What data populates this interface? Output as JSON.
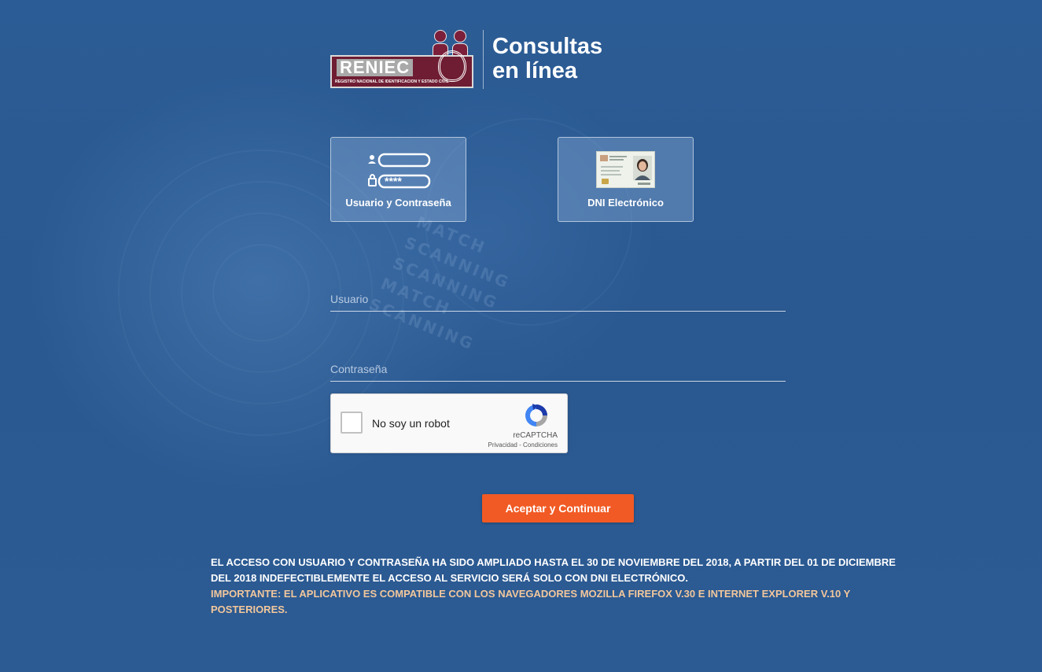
{
  "header": {
    "logo_word": "RENIEC",
    "logo_subtitle": "REGISTRO NACIONAL DE IDENTIFICACIÓN Y ESTADO CIVIL",
    "title_line1": "Consultas",
    "title_line2": "en línea"
  },
  "login_options": [
    {
      "label": "Usuario y Contraseña",
      "icon": "credentials-icon",
      "mask": "****"
    },
    {
      "label": "DNI Electrónico",
      "icon": "dni-card-icon"
    }
  ],
  "form": {
    "username_placeholder": "Usuario",
    "password_placeholder": "Contraseña",
    "username_value": "",
    "password_value": ""
  },
  "recaptcha": {
    "label": "No soy un robot",
    "brand": "reCAPTCHA",
    "privacy": "Privacidad",
    "separator": " - ",
    "terms": "Condiciones"
  },
  "submit_label": "Aceptar y Continuar",
  "notice": {
    "main": "EL ACCESO CON USUARIO Y CONTRASEÑA HA SIDO AMPLIADO HASTA EL 30 DE NOVIEMBRE DEL 2018, A PARTIR DEL 01 DE DICIEMBRE DEL 2018 INDEFECTIBLEMENTE EL ACCESO AL SERVICIO SERÁ SOLO CON DNI ELECTRÓNICO.",
    "important": "IMPORTANTE: EL APLICATIVO ES COMPATIBLE CON LOS NAVEGADORES MOZILLA FIREFOX V.30 E INTERNET EXPLORER V.10 Y POSTERIORES."
  },
  "background_words": [
    "MATCH",
    "SCANNING",
    "SCANNING",
    "MATCH",
    "SCANNING"
  ],
  "colors": {
    "background": "#2b5a92",
    "button": "#f15a24",
    "notice_important": "#f2c79c",
    "logo_maroon": "#6f1d33"
  }
}
